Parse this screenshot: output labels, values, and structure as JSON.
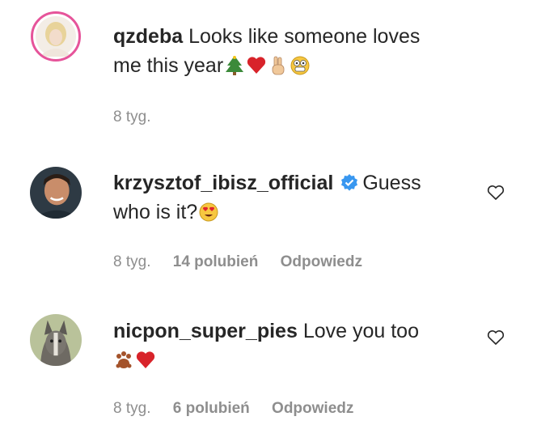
{
  "comments": [
    {
      "username": "qzdeba",
      "text_line1": "Looks like someone loves",
      "text_line2": "me this year",
      "time": "8 tyg.",
      "emojis": [
        "tree-emoji",
        "heart-emoji",
        "peace-hand-emoji",
        "grin-emoji"
      ]
    },
    {
      "username": "krzysztof_ibisz_official",
      "text_line1": "Guess",
      "text_line2": "who is it?",
      "time": "8 tyg.",
      "likes": "14 polubień",
      "reply": "Odpowiedz",
      "verified": true,
      "emojis": [
        "heart-eyes-emoji"
      ]
    },
    {
      "username": "nicpon_super_pies",
      "text_line1": "Love you too",
      "time": "8 tyg.",
      "likes": "6 polubień",
      "reply": "Odpowiedz",
      "emojis": [
        "paw-emoji",
        "heart-emoji"
      ]
    }
  ],
  "icons": {
    "like": "heart-outline-icon",
    "verified": "verified-badge-icon"
  },
  "colors": {
    "username": "#262626",
    "meta": "#8e8e8e",
    "verified": "#3897f0",
    "avatar_ring": "#e6549a"
  }
}
